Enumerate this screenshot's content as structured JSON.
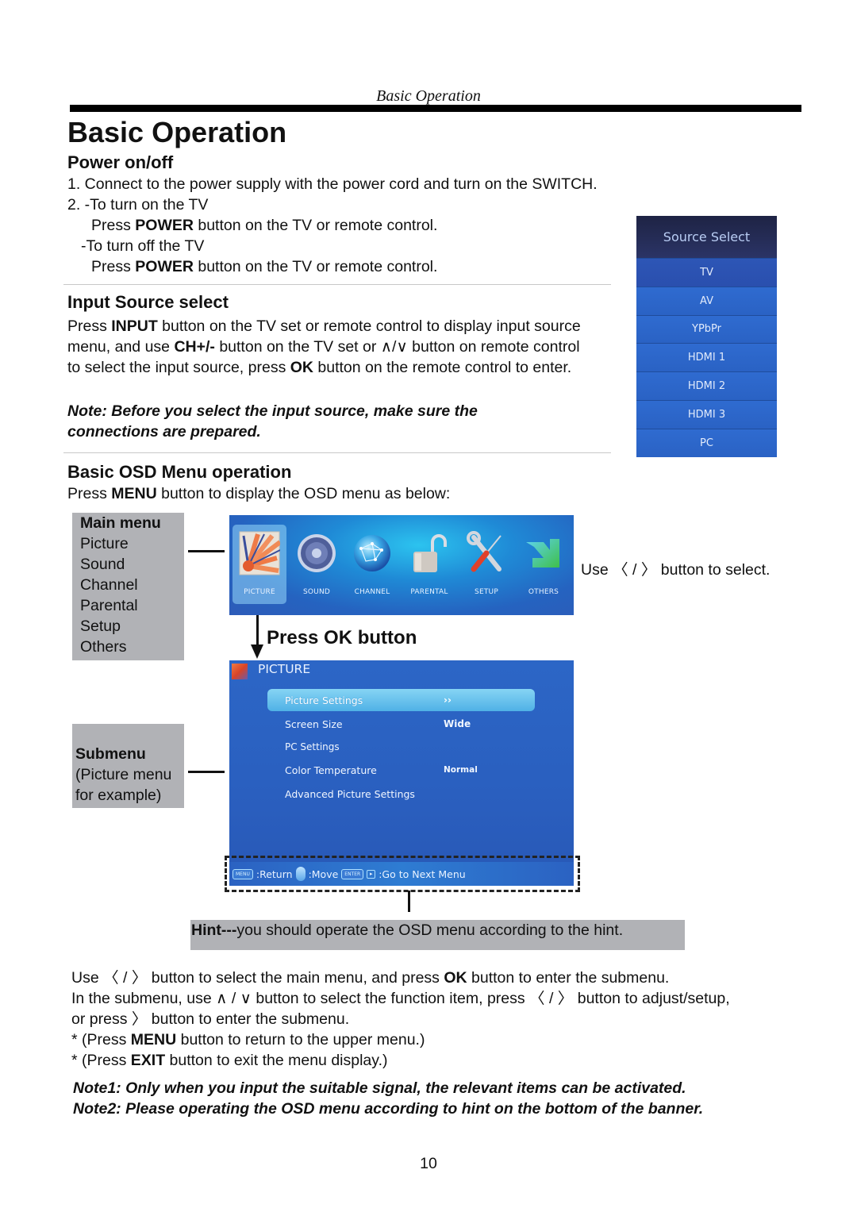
{
  "running_header": "Basic Operation",
  "page_title": "Basic Operation",
  "power": {
    "title": "Power on/off",
    "lines": [
      {
        "pre": "1. Connect to the power supply with the power cord and turn on the  SWITCH.",
        "bold": "",
        "post": ""
      },
      {
        "pre": "2. -To turn on the TV",
        "bold": "",
        "post": ""
      },
      {
        "pre": "Press ",
        "bold": "POWER",
        "post": " button on the TV or remote control."
      },
      {
        "pre": "-To turn off the TV",
        "bold": "",
        "post": ""
      },
      {
        "pre": "Press ",
        "bold": "POWER",
        "post": " button on the TV or remote control."
      }
    ]
  },
  "input_source": {
    "title": "Input Source select",
    "text": {
      "p1": "Press ",
      "b1": "INPUT",
      "p2": " button on the TV set or remote control to display input source menu, and use ",
      "b2": "CH+/-",
      "p3": " button on the TV set or ",
      "arrows": "∧/∨",
      "p4": "  button on remote control to select the input source, press ",
      "b3": "OK",
      "p5": " button on the remote control to enter."
    },
    "note": "Note: Before you select the input source, make sure the connections are prepared."
  },
  "source_select_panel": {
    "title": "Source Select",
    "items": [
      "TV",
      "AV",
      "YPbPr",
      "HDMI 1",
      "HDMI 2",
      "HDMI 3",
      "PC"
    ],
    "selected": "TV"
  },
  "osd": {
    "title": "Basic OSD Menu operation",
    "intro": {
      "p1": "Press ",
      "b1": "MENU",
      "p2": " button to display the OSD menu as below:"
    },
    "main_menu_label": {
      "title": "Main menu",
      "items": [
        "Picture",
        "Sound",
        "Channel",
        "Parental",
        "Setup",
        "Others"
      ]
    },
    "main_menu_banner": {
      "items": [
        {
          "label": "PICTURE",
          "icon": "picture-icon"
        },
        {
          "label": "SOUND",
          "icon": "speaker-icon"
        },
        {
          "label": "CHANNEL",
          "icon": "globe-icon"
        },
        {
          "label": "PARENTAL",
          "icon": "unlock-icon"
        },
        {
          "label": "SETUP",
          "icon": "tools-icon"
        },
        {
          "label": "OTHERS",
          "icon": "arrow-icon"
        }
      ],
      "selected": "PICTURE"
    },
    "use_select": {
      "p1": "Use ",
      "arrows": "〈 / 〉",
      "p2": " button to select."
    },
    "press_ok": "Press OK button",
    "submenu_label": {
      "title": "Submenu",
      "lines": [
        "(Picture menu",
        "for example)"
      ]
    },
    "submenu_panel": {
      "title": "PICTURE",
      "rows": [
        {
          "label": "Picture Settings",
          "value": "››",
          "highlighted": true
        },
        {
          "label": "Screen Size",
          "value": "Wide",
          "highlighted": false
        },
        {
          "label": "PC Settings",
          "value": "",
          "highlighted": false
        },
        {
          "label": "Color Temperature",
          "value": "Normal",
          "highlighted": false
        },
        {
          "label": "Advanced Picture Settings",
          "value": "",
          "highlighted": false
        }
      ],
      "hint_bar": {
        "menu_key": "MENU",
        "return": ":Return",
        "move": ":Move",
        "enter_key": "ENTER",
        "next": ":Go to Next Menu"
      }
    },
    "hint": {
      "bold": "Hint---",
      "text": "you should operate the OSD menu according to the hint."
    }
  },
  "instructions": [
    {
      "parts": [
        {
          "t": "Use "
        },
        {
          "a": "〈 / 〉"
        },
        {
          "t": " button to select the main menu, and press "
        },
        {
          "b": "OK"
        },
        {
          "t": " button to enter the submenu."
        }
      ]
    },
    {
      "parts": [
        {
          "t": "In the submenu, use "
        },
        {
          "a": "∧ / ∨"
        },
        {
          "t": " button to select the function item, press "
        },
        {
          "a": "〈 / 〉"
        },
        {
          "t": " button to adjust/setup,"
        }
      ]
    },
    {
      "parts": [
        {
          "t": "or press  "
        },
        {
          "a": "〉"
        },
        {
          "t": "  button to enter the submenu."
        }
      ]
    },
    {
      "parts": [
        {
          "t": "* (Press "
        },
        {
          "b": "MENU"
        },
        {
          "t": " button to return to the upper menu.)"
        }
      ]
    },
    {
      "parts": [
        {
          "t": "* (Press "
        },
        {
          "b": "EXIT"
        },
        {
          "t": " button to exit the menu display.)"
        }
      ]
    }
  ],
  "notes": [
    "Note1: Only when you input the suitable signal, the relevant items can be activated.",
    "Note2: Please operating the OSD menu according to hint on the bottom of the banner."
  ],
  "page_number": "10"
}
